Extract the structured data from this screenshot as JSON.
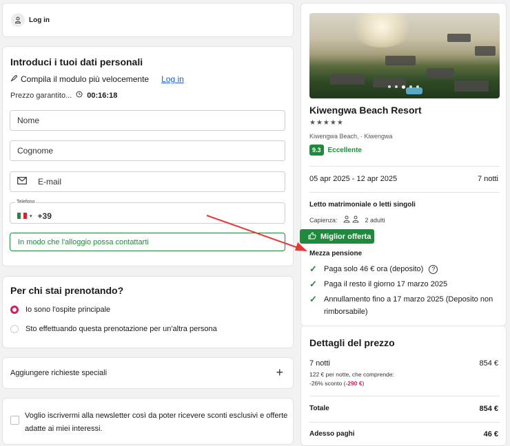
{
  "login": {
    "label": "Log in"
  },
  "personal": {
    "title": "Introduci i tuoi dati personali",
    "quick_fill": "Compila il modulo più velocemente",
    "login_link": "Log in",
    "guarantee": "Prezzo garantito...",
    "timer": "00:16:18",
    "name_placeholder": "Nome",
    "surname_placeholder": "Cognome",
    "email_placeholder": "E-mail",
    "phone_label": "Telefono",
    "phone_prefix": "+39",
    "phone_hint": "In modo che l'alloggio possa contattarti"
  },
  "for_who": {
    "title": "Per chi stai prenotando?",
    "option_main": "Io sono l'ospite principale",
    "option_other": "Sto effettuando questa prenotazione per un'altra persona"
  },
  "special": {
    "label": "Aggiungere richieste speciali"
  },
  "newsletter": {
    "text": "Voglio iscrivermi alla newsletter così da poter ricevere sconti esclusivi e offerte adatte ai miei interessi."
  },
  "hotel": {
    "name": "Kiwengwa Beach Resort",
    "stars": "★★★★★",
    "location": "Kiwengwa Beach, · Kiwengwa",
    "rating": "9.3",
    "rating_label": "Eccellente",
    "dates": "05 apr 2025 - 12 apr 2025",
    "nights": "7 notti",
    "room": "Letto matrimoniale o letti singoli",
    "capacity_label": "Capienza:",
    "capacity_value": "2 adulti",
    "best_offer": "Miglior offerta",
    "board": "Mezza pensione",
    "perks": [
      "Paga solo 46 € ora (deposito)",
      "Paga il resto il giorno 17 marzo 2025",
      "Annullamento fino a 17 marzo 2025 (Deposito non rimborsabile)"
    ]
  },
  "price": {
    "title": "Dettagli del prezzo",
    "nights_label": "7 notti",
    "nights_amount": "854 €",
    "per_night": "122 € per notte, che comprende:",
    "discount_label": "-26% sconto (",
    "discount_value": "-290 €",
    "discount_close": ")",
    "total_label": "Totale",
    "total_amount": "854 €",
    "now_label": "Adesso paghi",
    "now_amount": "46 €"
  },
  "colors": {
    "green": "#1f8a3b",
    "pink": "#d81b60",
    "arrow": "#e53935"
  }
}
